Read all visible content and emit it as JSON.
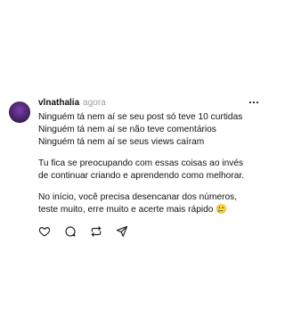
{
  "post": {
    "username": "vlnathalia",
    "time": "agora",
    "more_icon": "ellipsis-icon",
    "paragraphs": [
      {
        "lines": [
          "Ninguém tá nem aí se seu post só teve 10 curtidas",
          "Ninguém tá nem aí se não teve comentários",
          "Ninguém tá nem aí se seus views caíram"
        ]
      },
      {
        "lines": [
          "Tu fica se preocupando com essas coisas ao invés",
          "de continuar criando e aprendendo como melhorar."
        ]
      },
      {
        "lines": [
          "No início, você precisa desencanar dos números,",
          "teste muito, erre muito e acerte mais rápido 🥲"
        ]
      }
    ],
    "actions": [
      {
        "icon": "heart-icon"
      },
      {
        "icon": "comment-icon"
      },
      {
        "icon": "repost-icon"
      },
      {
        "icon": "share-icon"
      }
    ]
  }
}
